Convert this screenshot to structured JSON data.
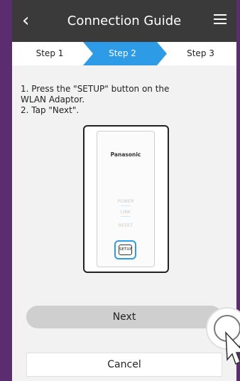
{
  "header": {
    "title": "Connection Guide",
    "back_icon": "chevron-left-icon",
    "menu_icon": "hamburger-menu-icon"
  },
  "steps": [
    {
      "label": "Step 1",
      "active": false
    },
    {
      "label": "Step 2",
      "active": true
    },
    {
      "label": "Step 3",
      "active": false
    }
  ],
  "instructions": "1. Press the \"SETUP\" button on the\nWLAN Adaptor.\n2. Tap \"Next\".",
  "device": {
    "brand": "Panasonic",
    "labels": [
      "POWER",
      "LINK",
      "RESET"
    ],
    "setup_label": "SETUP"
  },
  "buttons": {
    "next": "Next",
    "cancel": "Cancel"
  },
  "colors": {
    "header_bg": "#3a3a3a",
    "active_step": "#2d9be6",
    "highlight_ring": "#2d9be6",
    "next_bg": "#cfcfcf",
    "frame": "#5b2c6f"
  }
}
